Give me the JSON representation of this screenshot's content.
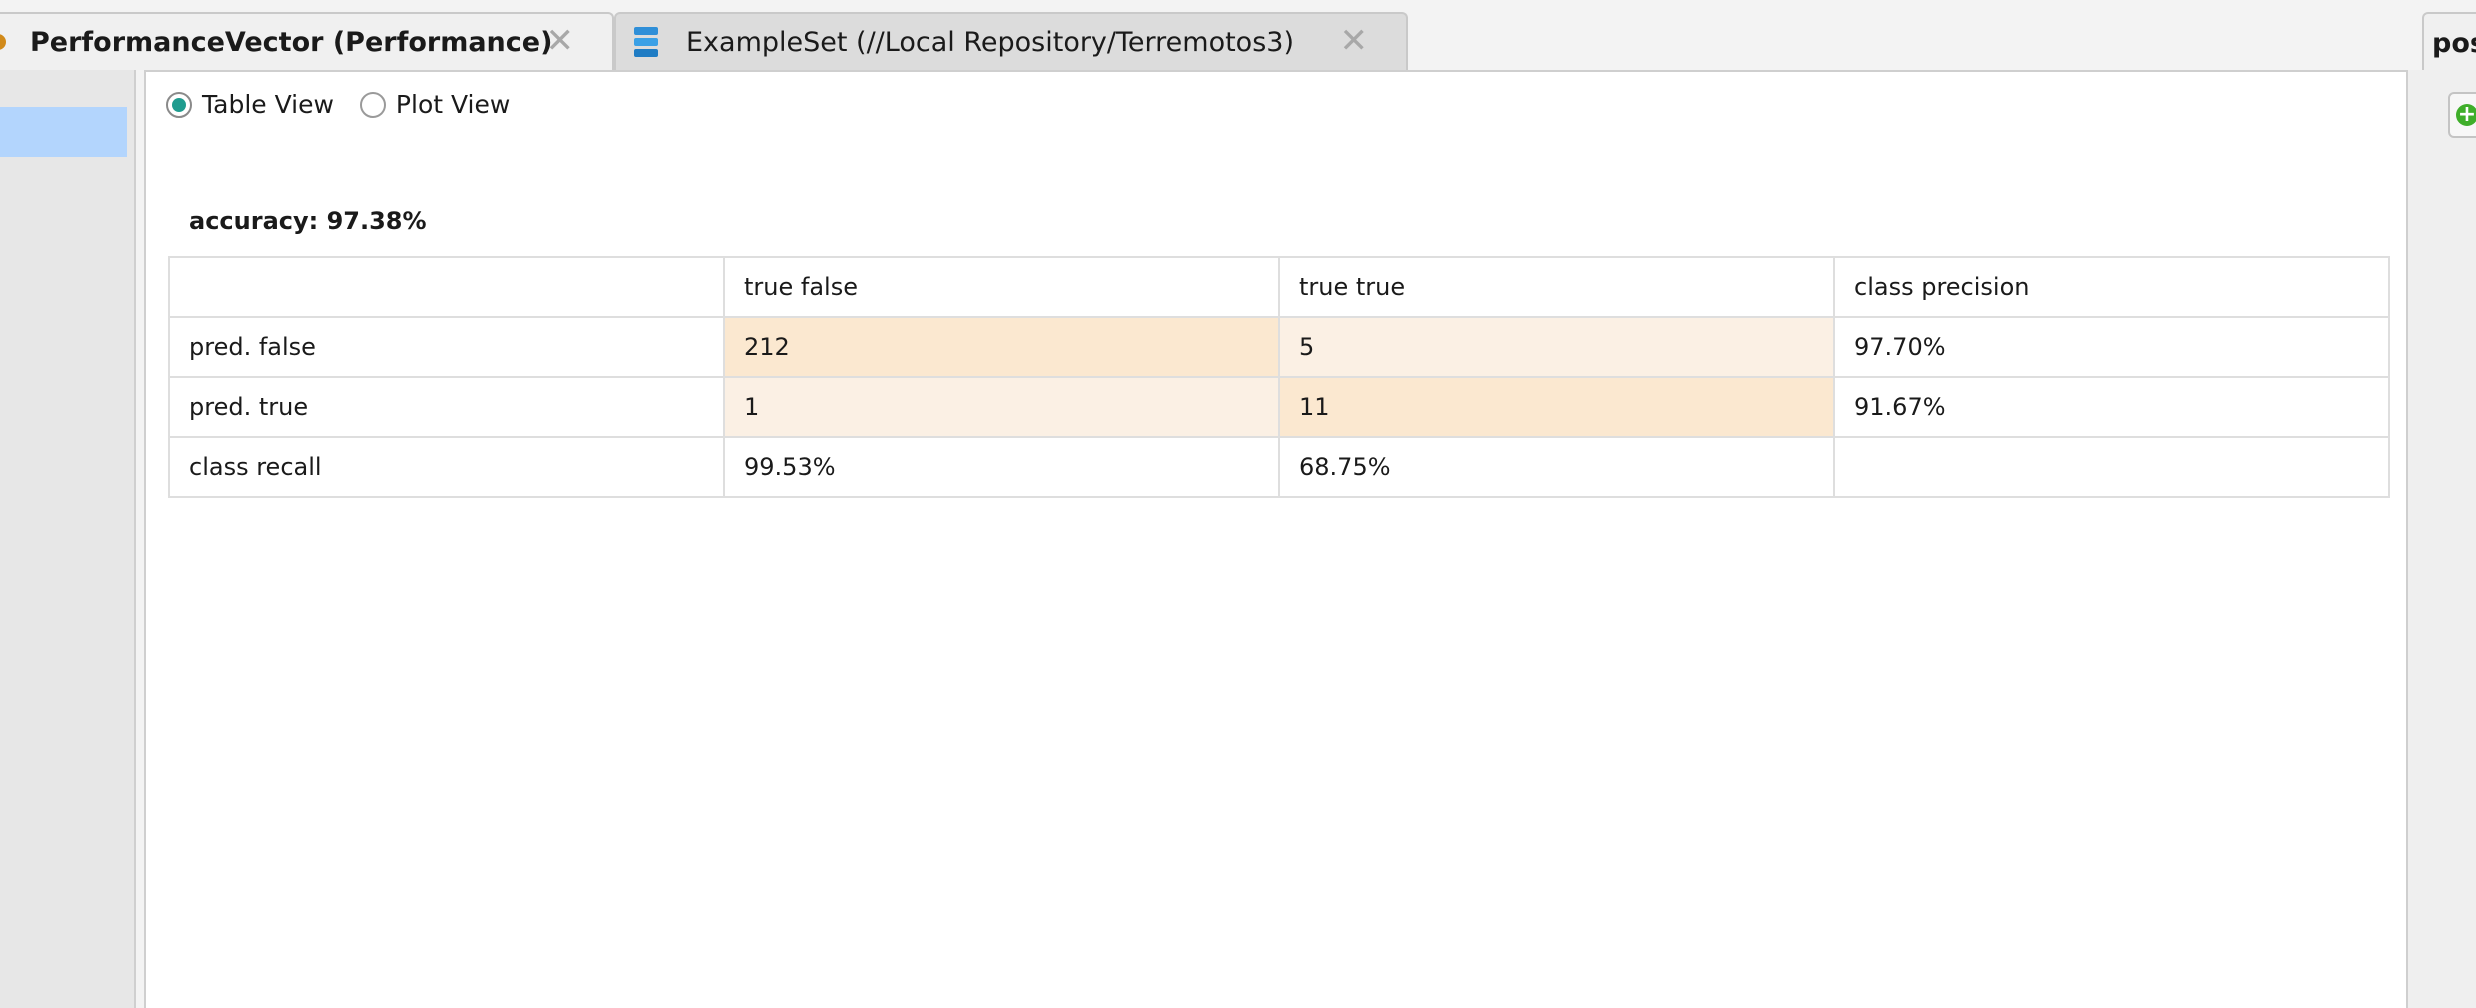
{
  "tabs": [
    {
      "label": "PerformanceVector (Performance)",
      "close_glyph": "✕",
      "icon": "performance-icon"
    },
    {
      "label": "ExampleSet (//Local Repository/Terremotos3)",
      "close_glyph": "✕",
      "icon": "database-icon"
    }
  ],
  "right_tab": {
    "label": "pos"
  },
  "view_toggle": {
    "options": [
      {
        "label": "Table View",
        "selected": true
      },
      {
        "label": "Plot View",
        "selected": false
      }
    ]
  },
  "accuracy": {
    "text": "accuracy: 97.38%"
  },
  "table": {
    "headers": [
      "",
      "true false",
      "true true",
      "class precision"
    ],
    "rows": [
      [
        "pred. false",
        "212",
        "5",
        "97.70%"
      ],
      [
        "pred. true",
        "1",
        "11",
        "91.67%"
      ],
      [
        "class recall",
        "99.53%",
        "68.75%",
        ""
      ]
    ]
  },
  "right_panel": {
    "add_button_glyph": "+"
  },
  "colors": {
    "accent_radio": "#1f9c8f",
    "sidebar_selection": "#b3d5fd",
    "cell_strong": "#fbe8d0",
    "cell_weak": "#fbf0e4",
    "add_icon": "#3fae2a"
  }
}
